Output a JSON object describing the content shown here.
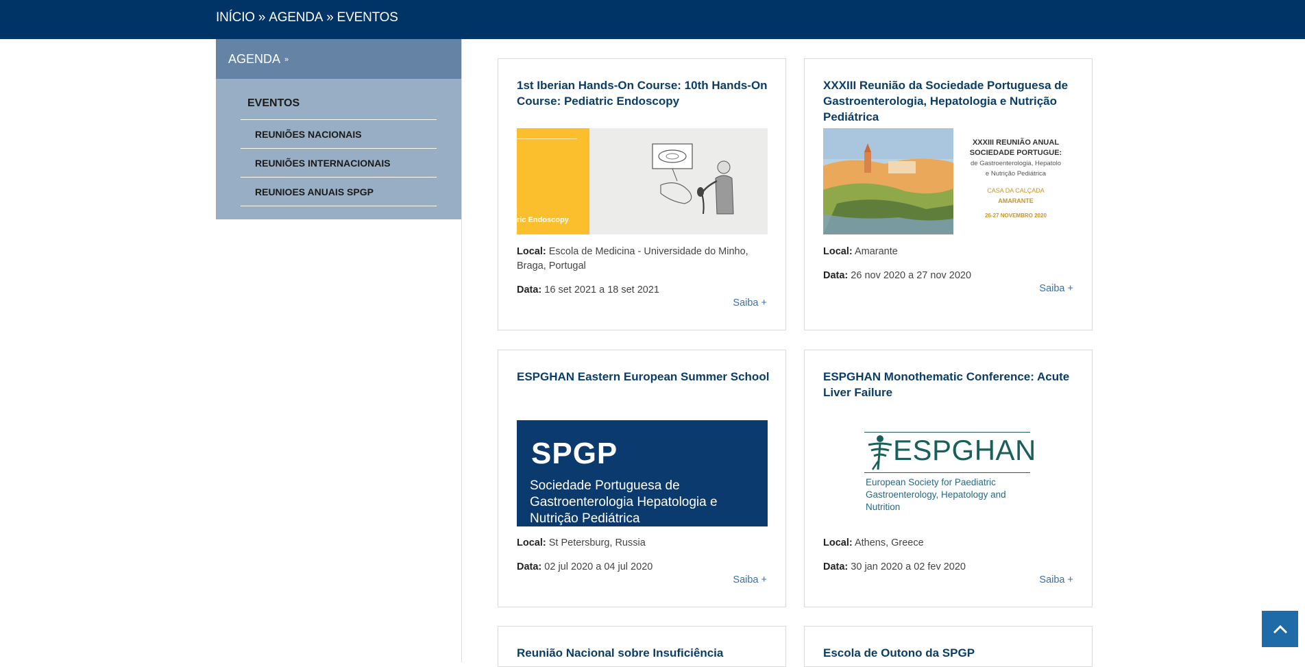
{
  "breadcrumb": {
    "home": "INÍCIO",
    "section": "AGENDA",
    "current": "EVENTOS",
    "sep": "»"
  },
  "sidebar": {
    "heading": "AGENDA",
    "subheading": "EVENTOS",
    "items": [
      {
        "label": "REUNIÕES NACIONAIS"
      },
      {
        "label": "REUNIÕES INTERNACIONAIS"
      },
      {
        "label": "REUNIOES ANUAIS SPGP"
      }
    ]
  },
  "labels": {
    "local": "Local:",
    "data": "Data:",
    "saiba": "Saiba +"
  },
  "events": [
    {
      "title": "1st Iberian Hands-On Course: 10th Hands-On Course: Pediatric Endoscopy",
      "image_caption": "ric Endoscopy",
      "local": "Escola de Medicina - Universidade do Minho, Braga, Portugal",
      "date": "16 set 2021 a 18 set 2021"
    },
    {
      "title": "XXXIII Reunião da Sociedade Portuguesa de Gastroenterologia, Hepatologia e Nutrição Pediátrica",
      "image_lines": [
        "XXXIII REUNIÃO ANUAL",
        "SOCIEDADE PORTUGUE:",
        "de Gastroenterologia, Hepatolo",
        "e Nutrição Pediátrica",
        "CASA DA CALÇADA",
        "AMARANTE",
        "26-27 NOVEMBRO 2020"
      ],
      "local": "Amarante",
      "date": "26 nov 2020 a 27 nov 2020"
    },
    {
      "title": "ESPGHAN Eastern European Summer School",
      "image_lines": [
        "SPGP",
        "Sociedade Portuguesa de",
        "Gastroenterologia Hepatologia e",
        "Nutrição Pediátrica"
      ],
      "local": "St Petersburg, Russia",
      "date": "02 jul 2020 a 04 jul 2020"
    },
    {
      "title": "ESPGHAN Monothematic Conference: Acute Liver Failure",
      "image_lines": [
        "ESPGHAN",
        "European Society for Paediatric",
        "Gastroenterology, Hepatology and",
        "Nutrition"
      ],
      "local": "Athens, Greece",
      "date": "30 jan 2020 a 02 fev 2020"
    },
    {
      "title": "Reunião Nacional sobre Insuficiência"
    },
    {
      "title": "Escola de Outono da SPGP"
    }
  ],
  "colors": {
    "topbar": "#003366",
    "sidebar_head": "#6584a5",
    "sidebar_body": "#98aec4",
    "title": "#0b3d66",
    "link": "#3b6fa3",
    "scroll_top": "#1f6ba8"
  },
  "icons": {
    "scroll_top": "chevron-up-icon",
    "sidebar_toggle": "double-chevron-down-icon"
  }
}
